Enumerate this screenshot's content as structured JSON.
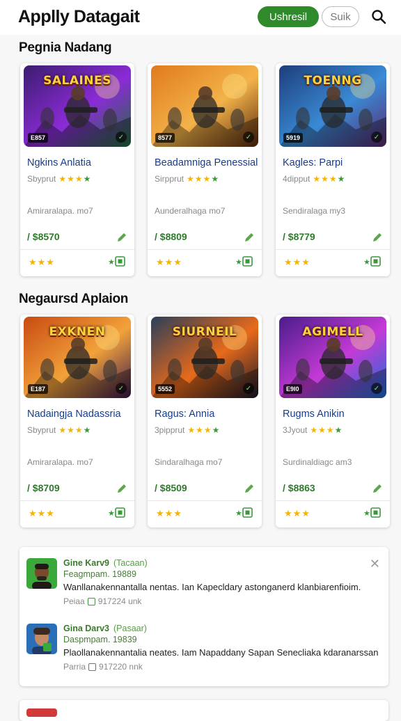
{
  "header": {
    "app_title": "Applly Datagait",
    "tabs": [
      "Ushresil",
      "Suik"
    ],
    "search_icon": "search-icon"
  },
  "sections": [
    {
      "title": "Pegnia Nadang",
      "cards": [
        {
          "thumb_title": "SALAINES",
          "badge": "E857",
          "name": "Ngkins Anlatia",
          "sub": "Sbyprut",
          "desc": "Amiraralapa. mo7",
          "price": "$8570",
          "theme": "purple"
        },
        {
          "thumb_title": "",
          "badge": "8577",
          "name": "Beadamniga Penessial",
          "sub": "Sirpprut",
          "desc": "Aunderalhaga mo7",
          "price": "$8809",
          "theme": "orange"
        },
        {
          "thumb_title": "TOENNG",
          "badge": "5919",
          "name": "Kagles: Parpi",
          "sub": "4dipput",
          "desc": "Sendiralaga my3",
          "price": "$8779",
          "theme": "blue"
        }
      ]
    },
    {
      "title": "Negaursd Aplaion",
      "cards": [
        {
          "thumb_title": "EXKNEN",
          "badge": "E187",
          "name": "Nadaingja Nadassria",
          "sub": "Sbyprut",
          "desc": "Amiraralapa. mo7",
          "price": "$8709",
          "theme": "fire"
        },
        {
          "thumb_title": "SIURNEIL",
          "badge": "5552",
          "name": "Ragus: Annia",
          "sub": "3pipprut",
          "desc": "Sindaralhaga mo7",
          "price": "$8509",
          "theme": "orange2"
        },
        {
          "thumb_title": "AGIMELL",
          "badge": "E9I0",
          "name": "Rugms Anikin",
          "sub": "3Jyout",
          "desc": "Surdinaldiagc am3",
          "price": "$8863",
          "theme": "violet"
        }
      ]
    }
  ],
  "notifications": [
    {
      "name": "Gine Karv9",
      "tag": "(Tacaan)",
      "sub": "Feagmpam.  19889",
      "message": "Wanllanakennantalla nentas. Ian Kapecldary astonganerd klanbiarenfioim.",
      "meta": "Peiaa",
      "time": "917224 unk"
    },
    {
      "name": "Gina Darv3",
      "tag": "(Pasaar)",
      "sub": "Daspmpam.  19839",
      "message": "Plaollanakennantalia neates. Iam Napaddany Sapan Senecliaka kdaranarssan",
      "meta": "Parria",
      "time": "917220 nnk"
    }
  ],
  "colors": {
    "accent": "#2f8a2c",
    "link": "#163d8c",
    "star": "#f4b400"
  }
}
